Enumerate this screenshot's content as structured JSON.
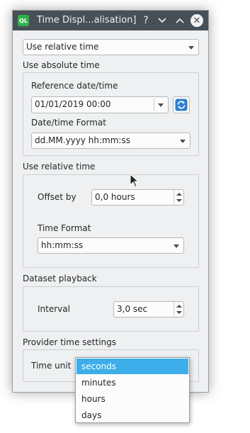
{
  "window": {
    "title": "Time Displ...alisation]",
    "icon_text": "QL",
    "help_glyph": "?",
    "minimize_glyph": "⌄",
    "maximize_glyph": "⌃",
    "close_glyph": "✕"
  },
  "mode_select": {
    "value": "Use relative time"
  },
  "absolute": {
    "heading": "Use absolute time",
    "reference_label": "Reference date/time",
    "reference_value": "01/01/2019 00:00",
    "format_label": "Date/time Format",
    "format_value": "dd.MM.yyyy hh:mm:ss"
  },
  "relative": {
    "heading": "Use relative time",
    "offset_label": "Offset by",
    "offset_value": "0,0 hours",
    "time_format_label": "Time Format",
    "time_format_value": "hh:mm:ss"
  },
  "playback": {
    "heading": "Dataset playback",
    "interval_label": "Interval",
    "interval_value": "3,0 sec"
  },
  "provider": {
    "heading": "Provider time settings",
    "time_unit_label": "Time unit"
  },
  "time_unit_popup": {
    "options": [
      "seconds",
      "minutes",
      "hours",
      "days"
    ],
    "selected_index": 0
  },
  "colors": {
    "titlebar": "#475057",
    "window_bg": "#eff0f1",
    "selection": "#3daee9",
    "refresh_icon": "#2e7fd1"
  }
}
